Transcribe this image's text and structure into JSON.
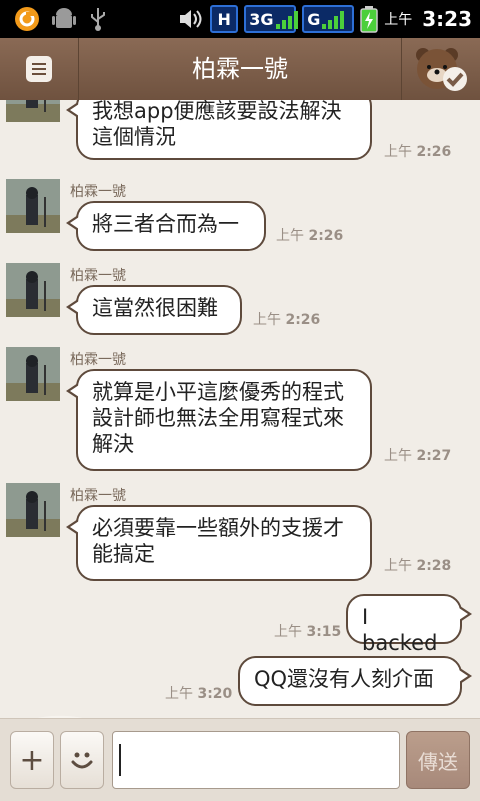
{
  "status_bar": {
    "ampm": "上午",
    "clock": "3:23",
    "net1": "H",
    "net2": "3G",
    "net3": "G"
  },
  "header": {
    "title": "柏霖一號"
  },
  "messages": [
    {
      "type": "in",
      "sender": "",
      "text": "我想app便應該要設法解決這個情況",
      "ampm": "上午",
      "time": "2:26"
    },
    {
      "type": "in",
      "sender": "柏霖一號",
      "text": "將三者合而為一",
      "ampm": "上午",
      "time": "2:26"
    },
    {
      "type": "in",
      "sender": "柏霖一號",
      "text": "這當然很困難",
      "ampm": "上午",
      "time": "2:26"
    },
    {
      "type": "in",
      "sender": "柏霖一號",
      "text": "就算是小平這麼優秀的程式設計師也無法全用寫程式來解決",
      "ampm": "上午",
      "time": "2:27"
    },
    {
      "type": "in",
      "sender": "柏霖一號",
      "text": "必須要靠一些額外的支援才能搞定",
      "ampm": "上午",
      "time": "2:28"
    },
    {
      "type": "out",
      "sender": "",
      "text": "I backed",
      "ampm": "上午",
      "time": "3:15"
    },
    {
      "type": "out",
      "sender": "",
      "text": "QQ還沒有人刻介面",
      "ampm": "上午",
      "time": "3:20"
    }
  ],
  "input_bar": {
    "add_symbol": "+",
    "input_value": "",
    "send_label": "傳送"
  },
  "colors": {
    "header": "#7a5c48",
    "bubble_border": "#5e4a3c",
    "background": "#f1ede7"
  }
}
